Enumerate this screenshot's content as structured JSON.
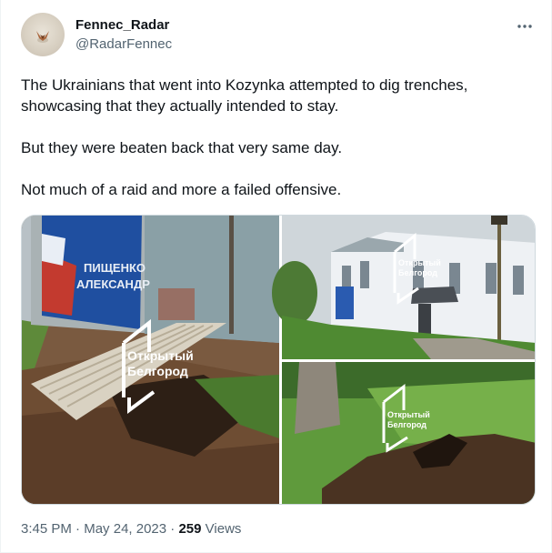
{
  "author": {
    "display_name": "Fennec_Radar",
    "handle": "@RadarFennec"
  },
  "more_icon": "more-horizontal-icon",
  "tweet": {
    "text": "The Ukrainians that went into Kozynka attempted to dig trenches, showcasing that they actually intended to stay.\n\nBut they were beaten back that very same day.\n\nNot much of a raid and more a failed offensive."
  },
  "media": {
    "watermark_line1": "Открытый",
    "watermark_line2": "Белгород",
    "banner_text_1": "ПИЩЕНКО",
    "banner_text_2": "АЛЕКСАНДР"
  },
  "meta": {
    "time": "3:45 PM",
    "separator": "·",
    "date": "May 24, 2023",
    "views_count": "259",
    "views_label": "Views"
  },
  "colors": {
    "text_primary": "#0f1419",
    "text_secondary": "#536471",
    "border": "#cfd9de"
  }
}
